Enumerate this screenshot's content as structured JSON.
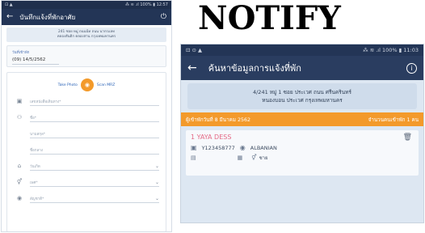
{
  "heading": "NOTIFY",
  "left_screen": {
    "status": {
      "left": "⊡ ▲",
      "right": "⁂ ≋ .ıl 100% ▮ 12:57"
    },
    "appbar": {
      "back": "←",
      "title": "บันทึกแจ้งที่พักอาศัย",
      "power": "⏻"
    },
    "address": {
      "line1": "241 ซอย หมู่ ถนนนีท ถนน นากรแลท",
      "line2": "คลองสันติก คลองสาน กรุงเทพมหานคร"
    },
    "date_card": {
      "label": "วันที่เข้าพัก",
      "value": "(09) 14/5/2562"
    },
    "photo": {
      "take_photo": "Take Photo",
      "scan_mrz": "Scan MRZ"
    },
    "fields": [
      {
        "icon": "▣",
        "placeholder": "เลขหนังสือเดินทาง*",
        "chev": ""
      },
      {
        "icon": "⚇",
        "placeholder": "ชื่อ*",
        "chev": ""
      },
      {
        "icon": "",
        "placeholder": "นามสกุล*",
        "chev": ""
      },
      {
        "icon": "",
        "placeholder": "ชื่อกลาง",
        "chev": ""
      },
      {
        "icon": "⌂",
        "placeholder": "วันเกิด",
        "chev": "⌄"
      },
      {
        "icon": "⚥",
        "placeholder": "เพศ*",
        "chev": "⌄"
      },
      {
        "icon": "◉",
        "placeholder": "สัญชาติ*",
        "chev": "⌄"
      }
    ]
  },
  "right_screen": {
    "status": {
      "left": "⊡ ⊙ ▲",
      "right": "⁂ ≋ .ıl 100% ▮ 11:03"
    },
    "appbar": {
      "back": "←",
      "title": "ค้นหาข้อมูลการแจ้งที่พัก",
      "info": "i"
    },
    "address": {
      "line1": "4/241 หมู่ 1 ซอย ประเวศ ถนน ศรีนครินทร์",
      "line2": "หนองบอน ประเวศ กรุงเทพมหานคร"
    },
    "orange_bar": {
      "left": "ผู้เข้าพักวันที่ 8 มีนาคม 2562",
      "right": "จำนวนคนเข้าพัก 1 คน"
    },
    "card": {
      "name": "1 YAYA DESS",
      "trash": "🗑",
      "passport_icon": "▣",
      "passport": "Y123458777",
      "globe_icon": "◉",
      "nationality": "ALBANIAN",
      "id_icon": "▤",
      "calendar_icon": "▦",
      "gender_icon": "⚥",
      "gender": "ชาย"
    }
  }
}
